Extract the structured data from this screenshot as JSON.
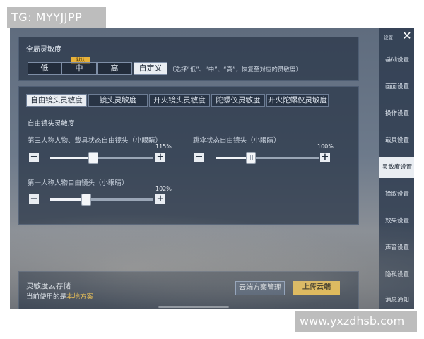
{
  "overlay": {
    "tg_label": "TG: MYYJJPP",
    "watermark": "www.yxzdhsb.com"
  },
  "global": {
    "title": "全局灵敏度",
    "options": [
      "低",
      "中",
      "高",
      "自定义"
    ],
    "selected_index": 3,
    "recommended_tag": "默认",
    "hint": "（选择“低”、“中”、“高”，恢复至对应的灵敏度）"
  },
  "tabs": [
    "自由镜头灵敏度",
    "镜头灵敏度",
    "开火镜头灵敏度",
    "陀螺仪灵敏度",
    "开火陀螺仪灵敏度"
  ],
  "active_tab": 0,
  "section_title": "自由镜头灵敏度",
  "sliders": [
    {
      "label": "第三人称人物、载具状态自由镜头（小眼睛）",
      "value_label": "115%",
      "value": 0.42
    },
    {
      "label": "跳伞状态自由镜头（小眼睛）",
      "value_label": "100%",
      "value": 0.34
    },
    {
      "label": "第一人称人物自由镜头（小眼睛）",
      "value_label": "102%",
      "value": 0.35
    }
  ],
  "cloud": {
    "title": "灵敏度云存储",
    "current_prefix": "当前使用的是",
    "current_plan": "本地方案",
    "plan_button": "云端方案管理",
    "upload_button": "上传云端"
  },
  "sidebar": {
    "top_label": "设置",
    "items": [
      "基础设置",
      "画面设置",
      "操作设置",
      "载具设置",
      "灵敏度设置",
      "拾取设置",
      "效果设置",
      "声音设置",
      "隐私设置",
      "消息通知"
    ],
    "active_index": 4
  },
  "colors": {
    "accent": "#f0c048",
    "highlight_text": "#f0c048",
    "panel": "#283446"
  }
}
